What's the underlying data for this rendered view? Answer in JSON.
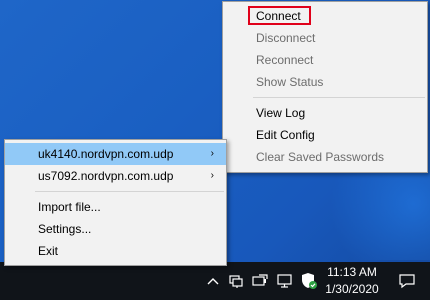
{
  "context_menu": {
    "items": [
      {
        "label": "Connect",
        "enabled": true,
        "highlighted": true
      },
      {
        "label": "Disconnect",
        "enabled": false
      },
      {
        "label": "Reconnect",
        "enabled": false
      },
      {
        "label": "Show Status",
        "enabled": false
      },
      {
        "label": "View Log",
        "enabled": true
      },
      {
        "label": "Edit Config",
        "enabled": true
      },
      {
        "label": "Clear Saved Passwords",
        "enabled": false
      }
    ]
  },
  "tray_menu": {
    "items": [
      {
        "label": "uk4140.nordvpn.com.udp",
        "submenu": true,
        "hovered": true
      },
      {
        "label": "us7092.nordvpn.com.udp",
        "submenu": true
      },
      {
        "label": "Import file...",
        "submenu": false
      },
      {
        "label": "Settings...",
        "submenu": false
      },
      {
        "label": "Exit",
        "submenu": false
      }
    ],
    "submenu_arrow": "›"
  },
  "taskbar": {
    "icons": [
      "chevron-up-icon",
      "network-icon",
      "power-icon",
      "monitor-icon",
      "openvpn-shield-icon"
    ],
    "time": "11:13 AM",
    "date": "1/30/2020",
    "notification_icon": "action-center-icon"
  },
  "colors": {
    "desktop": "#1a5fc2",
    "menu_bg": "#f2f2f2",
    "hover": "#91c9f7",
    "highlight_border": "#e0001a",
    "taskbar": "#101419"
  }
}
